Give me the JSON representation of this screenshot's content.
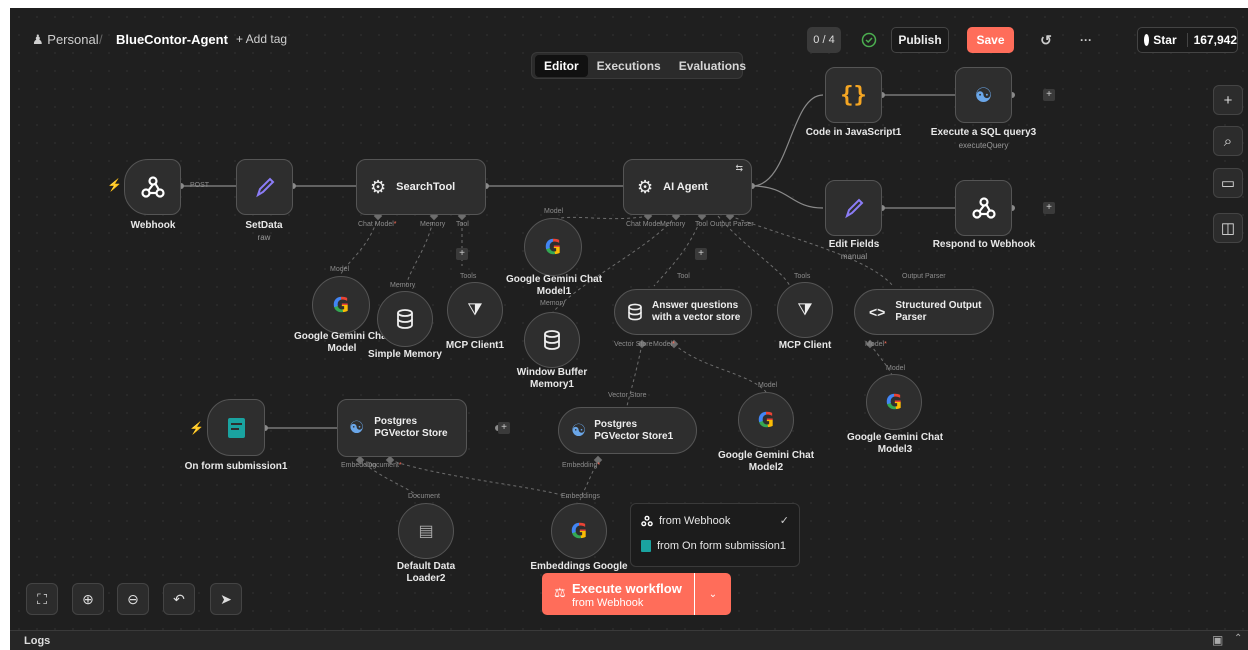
{
  "header": {
    "workspace": "Personal",
    "separator": "/",
    "workflow_name": "BlueContor-Agent",
    "add_tag": "+ Add tag",
    "counter": "0 / 4",
    "publish": "Publish",
    "save": "Save",
    "more": "···",
    "star_label": "Star",
    "star_count": "167,942"
  },
  "tabs": [
    "Editor",
    "Executions",
    "Evaluations"
  ],
  "nodes": {
    "webhook": {
      "label": "Webhook",
      "edge_label": "POST"
    },
    "setdata": {
      "label": "SetData",
      "sub": "raw"
    },
    "searchtool": {
      "label": "SearchTool",
      "ports": {
        "chat_model": "Chat Model",
        "memory": "Memory",
        "tool": "Tool"
      }
    },
    "aiagent": {
      "label": "AI Agent",
      "ports": {
        "chat_model": "Chat Model",
        "memory": "Memory",
        "tool": "Tool",
        "output_parser": "Output Parser"
      }
    },
    "code_js": {
      "label": "Code in JavaScript1"
    },
    "sql": {
      "label": "Execute a SQL query3",
      "sub": "executeQuery"
    },
    "edit_fields": {
      "label": "Edit Fields",
      "sub": "manual"
    },
    "respond": {
      "label": "Respond to Webhook"
    },
    "gemini_model": {
      "label": "Google Gemini Chat Model",
      "port": "Model"
    },
    "simple_memory": {
      "label": "Simple Memory",
      "port": "Memory"
    },
    "mcp_client1": {
      "label": "MCP Client1",
      "port": "Tools"
    },
    "gemini_model1": {
      "label": "Google Gemini Chat Model1",
      "port": "Model"
    },
    "window_memory": {
      "label": "Window Buffer Memory1",
      "port": "Memory"
    },
    "answer_vs": {
      "label": "Answer questions with a vector store",
      "port": "Tool",
      "ports": {
        "vector_store": "Vector Store",
        "model": "Model"
      }
    },
    "mcp_client": {
      "label": "MCP Client",
      "port": "Tools"
    },
    "structured_parser": {
      "label": "Structured Output Parser",
      "port": "Output Parser",
      "ports": {
        "model": "Model"
      }
    },
    "gemini_model3": {
      "label": "Google Gemini Chat Model3",
      "port": "Model"
    },
    "gemini_model2": {
      "label": "Google Gemini Chat Model2",
      "port": "Model"
    },
    "pgvector1": {
      "label": "Postgres PGVector Store1",
      "port": "Vector Store",
      "ports": {
        "embedding": "Embedding"
      }
    },
    "form": {
      "label": "On form submission1"
    },
    "pgvector": {
      "label": "Postgres PGVector Store",
      "ports": {
        "embedding": "Embedding",
        "document": "Document"
      }
    },
    "data_loader": {
      "label": "Default Data Loader2",
      "port": "Document"
    },
    "embeddings": {
      "label": "Embeddings Google",
      "port": "Embeddings"
    }
  },
  "trigger_menu": {
    "items": [
      {
        "label": "from Webhook",
        "selected": true
      },
      {
        "label": "from On form submission1",
        "selected": false
      }
    ]
  },
  "execute": {
    "title": "Execute workflow",
    "sub": "from Webhook"
  },
  "logs": {
    "label": "Logs"
  },
  "colors": {
    "accent": "#ff6d5a",
    "canvas": "#1f1f1f",
    "node": "#2e2e2e",
    "success": "#4caf50",
    "brush": "#8b7cf6"
  }
}
